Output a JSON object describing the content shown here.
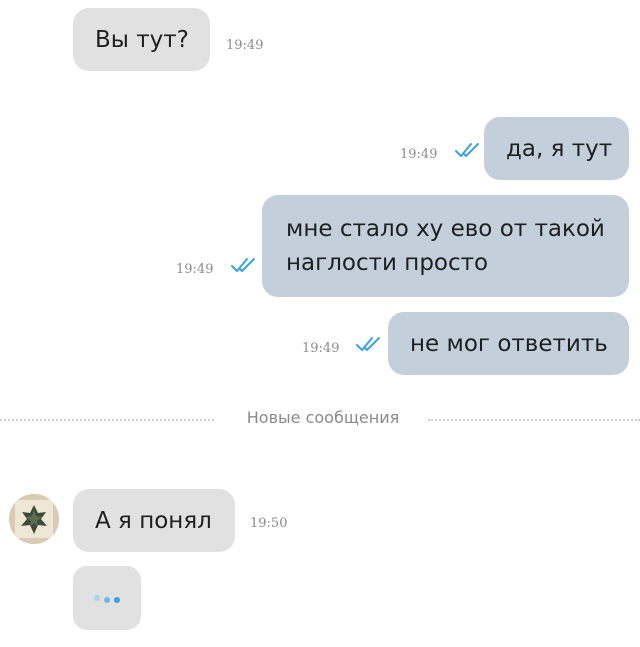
{
  "chat": {
    "messages": [
      {
        "direction": "incoming",
        "text": "Вы тут?",
        "time": "19:49"
      },
      {
        "direction": "outgoing",
        "text": "да, я тут",
        "time": "19:49",
        "status": "read"
      },
      {
        "direction": "outgoing",
        "lines": [
          "мне стало ху ево от такой",
          "наглости просто"
        ],
        "time": "19:49",
        "status": "read"
      },
      {
        "direction": "outgoing",
        "text": "не мог ответить",
        "time": "19:49",
        "status": "read"
      }
    ],
    "divider_label": "Новые сообщения",
    "new_messages": [
      {
        "direction": "incoming",
        "text": "А я понял",
        "time": "19:50"
      }
    ],
    "typing_indicator": {
      "icon": "typing-dots-icon"
    },
    "avatar_icon": "user-avatar-icon",
    "read_icon": "double-check-icon"
  },
  "colors": {
    "incoming_bubble": "#e1e1e1",
    "outgoing_bubble": "#c3d0dc",
    "read_ticks": "#3ba2e0",
    "timestamp": "#8a8a8a",
    "typing_dots": "#6fb6e8"
  }
}
